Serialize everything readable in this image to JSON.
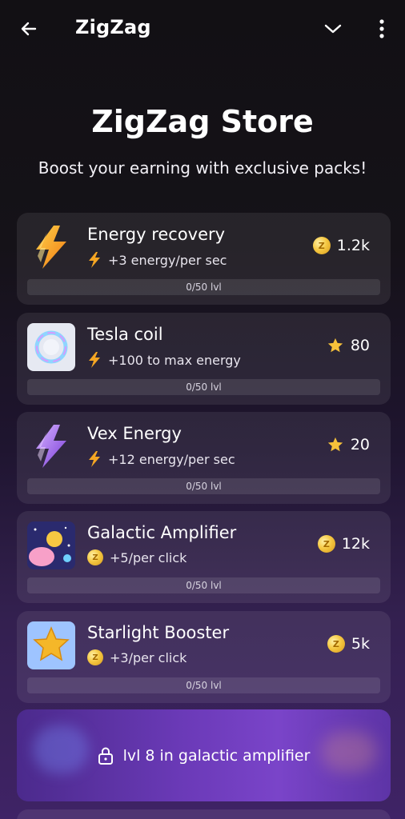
{
  "header": {
    "title": "ZigZag",
    "back_icon": "arrow-left-icon",
    "dropdown_icon": "chevron-down-icon",
    "more_icon": "more-vertical-icon"
  },
  "store": {
    "title": "ZigZag Store",
    "subtitle": "Boost your earning with exclusive packs!"
  },
  "items": [
    {
      "name": "Energy recovery",
      "bonus": "+3 energy/per sec",
      "bonus_icon": "lightning-icon",
      "price": "1.2k",
      "currency_icon": "coin-icon",
      "level": "0/50 lvl",
      "icon": "lightning-bolt-icon"
    },
    {
      "name": "Tesla coil",
      "bonus": "+100 to max energy",
      "bonus_icon": "lightning-icon",
      "price": "80",
      "currency_icon": "star-icon",
      "level": "0/50 lvl",
      "icon": "tesla-coil-icon"
    },
    {
      "name": "Vex Energy",
      "bonus": "+12 energy/per sec",
      "bonus_icon": "lightning-icon",
      "price": "20",
      "currency_icon": "star-icon",
      "level": "0/50 lvl",
      "icon": "purple-lightning-icon"
    },
    {
      "name": "Galactic Amplifier",
      "bonus": "+5/per click",
      "bonus_icon": "coin-icon",
      "price": "12k",
      "currency_icon": "coin-icon",
      "level": "0/50 lvl",
      "icon": "galactic-amplifier-icon"
    },
    {
      "name": "Starlight Booster",
      "bonus": "+3/per click",
      "bonus_icon": "coin-icon",
      "price": "5k",
      "currency_icon": "coin-icon",
      "level": "0/50 lvl",
      "icon": "starlight-booster-icon"
    }
  ],
  "locked": {
    "text": "lvl 8 in galactic amplifier",
    "icon": "lock-icon"
  },
  "colors": {
    "coin": "#f5c842",
    "star": "#f7c23a",
    "card_bg": "rgba(255,255,255,0.08)",
    "locked_bg": "#6b3ab8"
  }
}
